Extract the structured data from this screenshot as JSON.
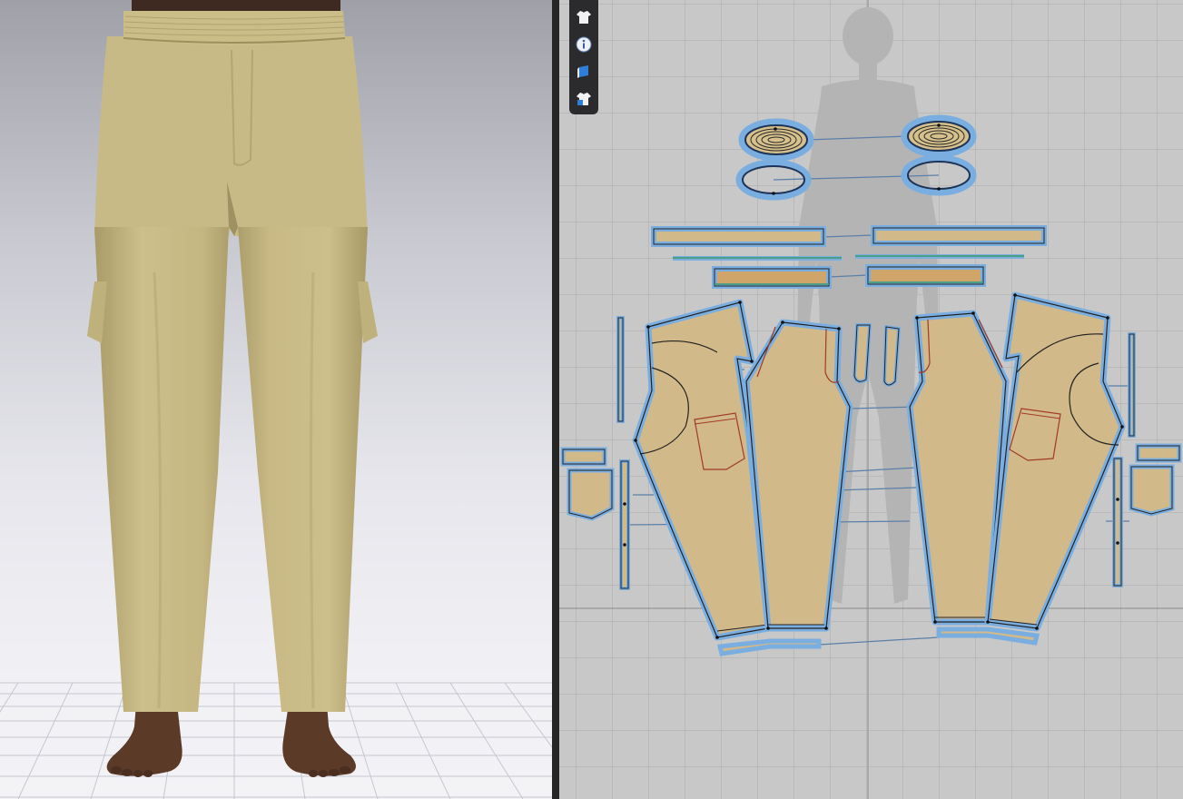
{
  "app": {
    "views": [
      "3d-avatar-view",
      "2d-pattern-view"
    ]
  },
  "toolbar_2d": {
    "tools": [
      {
        "name": "show-garment-2d",
        "icon": "tshirt-icon"
      },
      {
        "name": "info",
        "icon": "info-icon"
      },
      {
        "name": "texture",
        "icon": "texture-icon"
      },
      {
        "name": "garment-layer",
        "icon": "tshirt-lock-icon"
      }
    ]
  },
  "garment": {
    "fabric_color": "#c9bb88",
    "pattern_fill": "#d1b98a",
    "selection_outline": "#7aaee0",
    "seam_line": "#3c6aa8",
    "internal_line": "#a33a2a"
  },
  "avatar": {
    "skin_color": "#5b3a28",
    "silhouette_color": "#b4b4b4"
  }
}
